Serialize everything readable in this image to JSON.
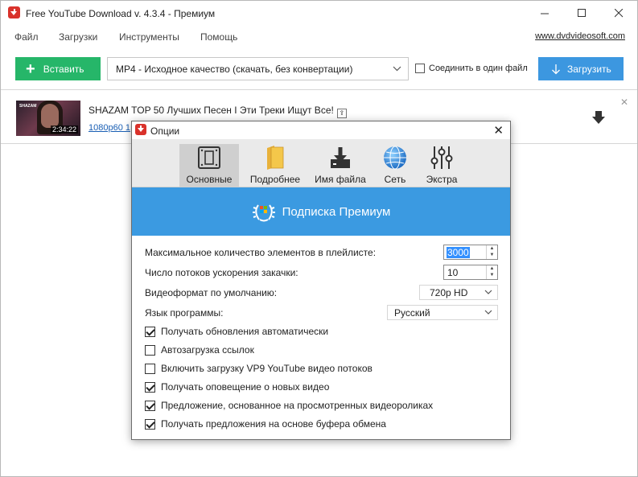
{
  "window": {
    "title": "Free YouTube Download v. 4.3.4 - Премиум"
  },
  "menu": {
    "items": [
      "Файл",
      "Загрузки",
      "Инструменты",
      "Помощь"
    ],
    "site_link": "www.dvdvideosoft.com"
  },
  "toolbar": {
    "paste_label": "Вставить",
    "format_value": "MP4 - Исходное качество (скачать, без конвертации)",
    "merge_label": "Соединить в один файл",
    "download_label": "Загрузить"
  },
  "download_item": {
    "title": "SHAZAM TOP 50 Лучших Песен I Эти Треки Ищут Все!",
    "subtitle": "1080p60 1",
    "duration": "2:34:22",
    "thumb_brand": "SHAZAM"
  },
  "dialog": {
    "title": "Опции",
    "tabs": [
      {
        "label": "Основные",
        "icon": "settings-panel-icon",
        "active": true
      },
      {
        "label": "Подробнее",
        "icon": "folder-icon",
        "active": false
      },
      {
        "label": "Имя файла",
        "icon": "file-download-icon",
        "active": false
      },
      {
        "label": "Сеть",
        "icon": "globe-icon",
        "active": false
      },
      {
        "label": "Экстра",
        "icon": "sliders-icon",
        "active": false
      }
    ],
    "premium_banner": "Подписка Премиум",
    "fields": {
      "playlist_max_label": "Максимальное количество элементов в плейлисте:",
      "playlist_max_value": "3000",
      "threads_label": "Число потоков ускорения закачки:",
      "threads_value": "10",
      "video_format_label": "Видеоформат по умолчанию:",
      "video_format_value": "720p HD",
      "language_label": "Язык программы:",
      "language_value": "Русский"
    },
    "checkboxes": [
      {
        "label": "Получать обновления автоматически",
        "checked": true
      },
      {
        "label": "Автозагрузка ссылок",
        "checked": false
      },
      {
        "label": "Включить загрузку VP9 YouTube видео потоков",
        "checked": false
      },
      {
        "label": "Получать оповещение о новых видео",
        "checked": true
      },
      {
        "label": "Предложение, основанное на просмотренных видеороликах",
        "checked": true
      },
      {
        "label": "Получать предложения на основе буфера обмена",
        "checked": true
      }
    ]
  },
  "colors": {
    "paste_button": "#26b669",
    "download_button": "#3c97e0",
    "premium_banner": "#3b9ae1",
    "logo": "#d9322b"
  }
}
